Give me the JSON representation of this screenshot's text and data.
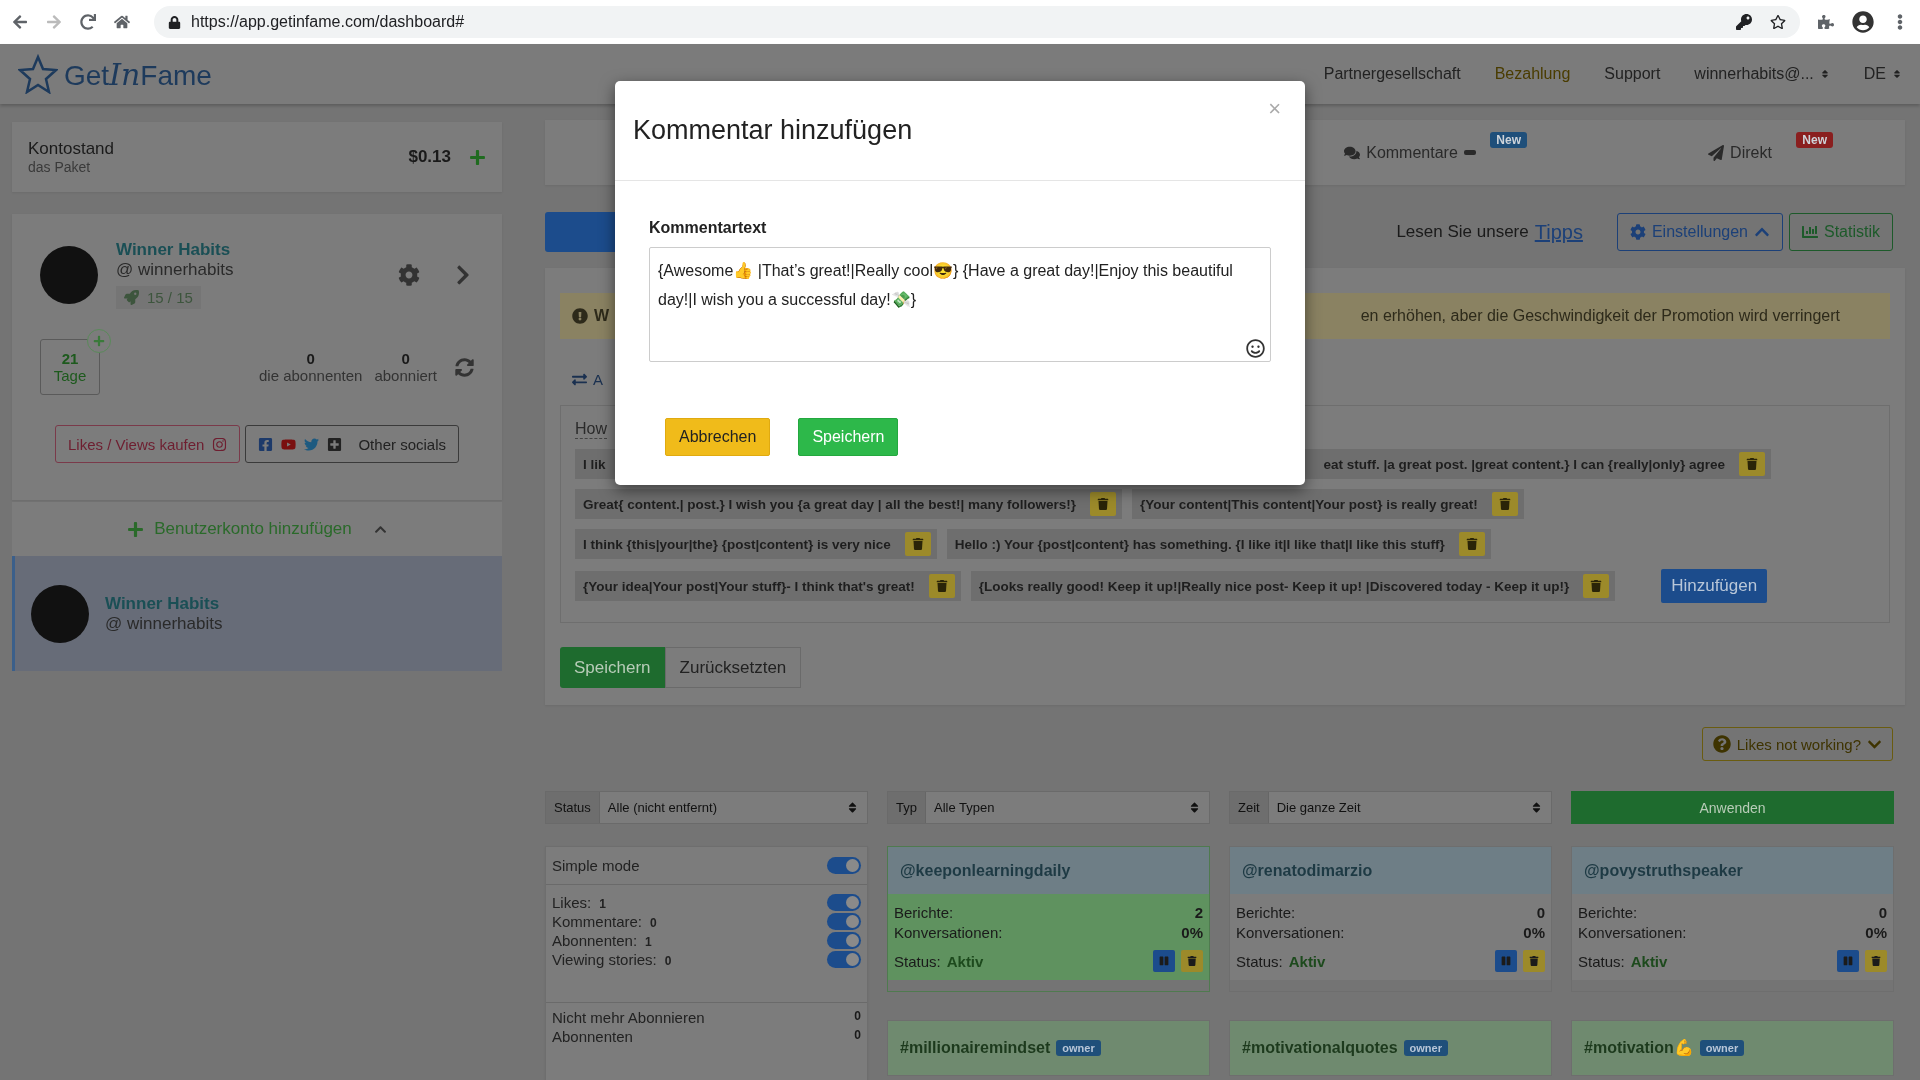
{
  "browser": {
    "url": "https://app.getinfame.com/dashboard#"
  },
  "header": {
    "logo": [
      "Get",
      "In",
      "Fame"
    ],
    "nav": [
      {
        "label": "Partnergesellschaft",
        "selected": false,
        "kind": "link"
      },
      {
        "label": "Bezahlung",
        "selected": true,
        "kind": "link"
      },
      {
        "label": "Support",
        "selected": false,
        "kind": "link"
      },
      {
        "label": "winnerhabits@...",
        "selected": false,
        "kind": "dropdown"
      },
      {
        "label": "DE",
        "selected": false,
        "kind": "dropdown"
      }
    ]
  },
  "balance": {
    "title": "Kontostand",
    "subtitle": "das Paket",
    "amount": "$0.13"
  },
  "profile": {
    "name": "Winner Habits",
    "handle": "@ winnerhabits",
    "rocket": "15 / 15",
    "days_value": "21",
    "days_label": "Tage",
    "stats": [
      {
        "value": "0",
        "label": "die abonnenten"
      },
      {
        "value": "0",
        "label": "abonniert"
      }
    ],
    "buttons": [
      {
        "label": "Likes / Views kaufen",
        "kind": "instagram"
      },
      {
        "label": "Other socials",
        "kind": "socials"
      }
    ]
  },
  "add_account": {
    "label": "Benutzerkonto hinzufügen",
    "expanded": true
  },
  "accounts": [
    {
      "name": "Winner Habits",
      "handle": "@ winnerhabits",
      "selected": true
    }
  ],
  "tabs": [
    {
      "label": "Kommentare",
      "kind": "comments",
      "badge": "New",
      "color": "#1f4f7a"
    },
    {
      "label": "Direkt",
      "kind": "direct",
      "badge": "New",
      "color": "#8a1f1f"
    }
  ],
  "toolbar": {
    "tips_prefix": "Lesen Sie unsere",
    "tips_link": "Tipps",
    "settings": {
      "label": "Einstellungen",
      "expanded": true
    },
    "stats": "Statistik"
  },
  "warning": {
    "start": "W",
    "end": "en erhöhen, aber die Geschwindigkeit der Promotion wird verringert"
  },
  "section_label": "A",
  "comments": {
    "heading": "How",
    "rows": [
      [
        {
          "parts": [
            "I lik",
            "eat stuff. |a great post. |great content.} I can {really|only} agree"
          ]
        }
      ],
      [
        {
          "parts": [
            "Great{ content.| post.} I wish you {a great day | all the best!| many followers!}"
          ]
        },
        {
          "parts": [
            "{Your content|This content|Your post} is really great!"
          ]
        }
      ],
      [
        {
          "parts": [
            "I think {this|your|the} {post|content} is very nice"
          ]
        },
        {
          "parts": [
            "Hello :) Your {post|content} has something. {I like it|I like that|I like this stuff}"
          ]
        }
      ],
      [
        {
          "parts": [
            "{Your idea|Your post|Your stuff}- I think that's great!"
          ]
        },
        {
          "parts": [
            "{Looks really good! Keep it up!|Really nice post- Keep it up! |Discovered today - Keep it up!}"
          ]
        }
      ]
    ],
    "add_button": "Hinzufügen",
    "save": "Speichern",
    "reset": "Zurücksetzten"
  },
  "help": "Likes not working?",
  "filters": [
    {
      "label": "Status",
      "value": "Alle (nicht entfernt)"
    },
    {
      "label": "Typ",
      "value": "Alle Typen"
    },
    {
      "label": "Zeit",
      "value": "Die ganze Zeit"
    }
  ],
  "apply": "Anwenden",
  "options": {
    "toggles": [
      {
        "label": "Simple mode",
        "on": true
      },
      {
        "label": "Likes:",
        "count": "1",
        "on": true
      },
      {
        "label": "Kommentare:",
        "count": "0",
        "on": true
      },
      {
        "label": "Abonnenten:",
        "count": "1",
        "on": true
      },
      {
        "label": "Viewing stories:",
        "count": "0",
        "on": true
      }
    ],
    "counters": [
      {
        "label": "Nicht mehr Abonnieren",
        "value": "0"
      },
      {
        "label": "Abonnenten",
        "value": "0"
      }
    ]
  },
  "cards": [
    {
      "title": "@keeponlearningdaily",
      "reports_label": "Berichte:",
      "reports": "2",
      "conversions_label": "Konversationen:",
      "conversions": "0%",
      "status_label": "Status:",
      "status": "Aktiv",
      "highlighted": true
    },
    {
      "title": "@renatodimarzio",
      "reports_label": "Berichte:",
      "reports": "0",
      "conversions_label": "Konversationen:",
      "conversions": "0%",
      "status_label": "Status:",
      "status": "Aktiv",
      "highlighted": false
    },
    {
      "title": "@povystruthspeaker",
      "reports_label": "Berichte:",
      "reports": "0",
      "conversions_label": "Konversationen:",
      "conversions": "0%",
      "status_label": "Status:",
      "status": "Aktiv",
      "highlighted": false
    }
  ],
  "hashtags": [
    {
      "title": "#millionairemindset",
      "badge": "owner"
    },
    {
      "title": "#motivationalquotes",
      "badge": "owner"
    },
    {
      "title": "#motivation💪",
      "badge": "owner"
    }
  ],
  "modal": {
    "title": "Kommentar hinzufügen",
    "close": "×",
    "field_label": "Kommentartext",
    "value": "{Awesome👍 |That’s great!|Really cool😎} {Have a great day!|Enjoy this beautiful day!|I wish you a successful day!💸}",
    "cancel": "Abbrechen",
    "save": "Speichern"
  }
}
